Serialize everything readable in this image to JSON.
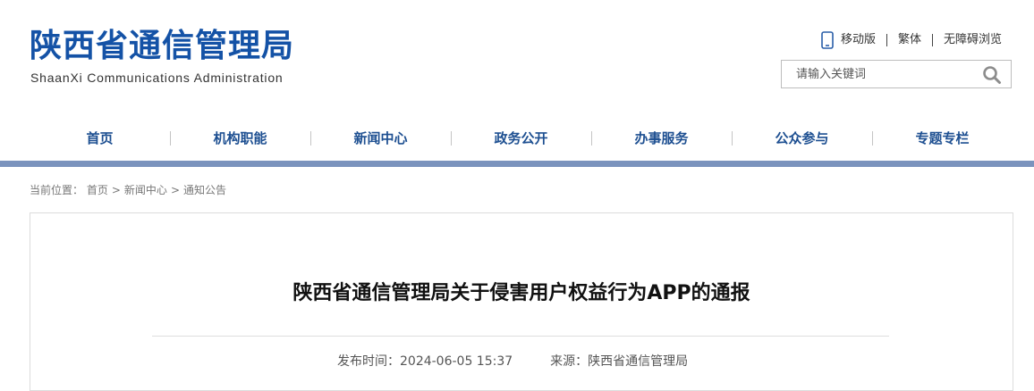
{
  "header": {
    "site_title_cn": "陕西省通信管理局",
    "site_title_en": "ShaanXi Communications Administration",
    "top_links": {
      "mobile": "移动版",
      "traditional": "繁体",
      "accessible": "无障碍浏览"
    },
    "search": {
      "placeholder": "请输入关键词",
      "icon": "search-icon"
    }
  },
  "nav": {
    "items": [
      "首页",
      "机构职能",
      "新闻中心",
      "政务公开",
      "办事服务",
      "公众参与",
      "专题专栏"
    ]
  },
  "breadcrumb": {
    "prefix": "当前位置：",
    "items": [
      "首页",
      "新闻中心",
      "通知公告"
    ],
    "separator": ">"
  },
  "article": {
    "title": "陕西省通信管理局关于侵害用户权益行为APP的通报",
    "publish_time_label": "发布时间：",
    "publish_time": "2024-06-05 15:37",
    "source_label": "来源：",
    "source": "陕西省通信管理局"
  },
  "colors": {
    "brand_blue": "#1452a6",
    "nav_text": "#1d4f91",
    "nav_bar": "#7b93bd"
  }
}
